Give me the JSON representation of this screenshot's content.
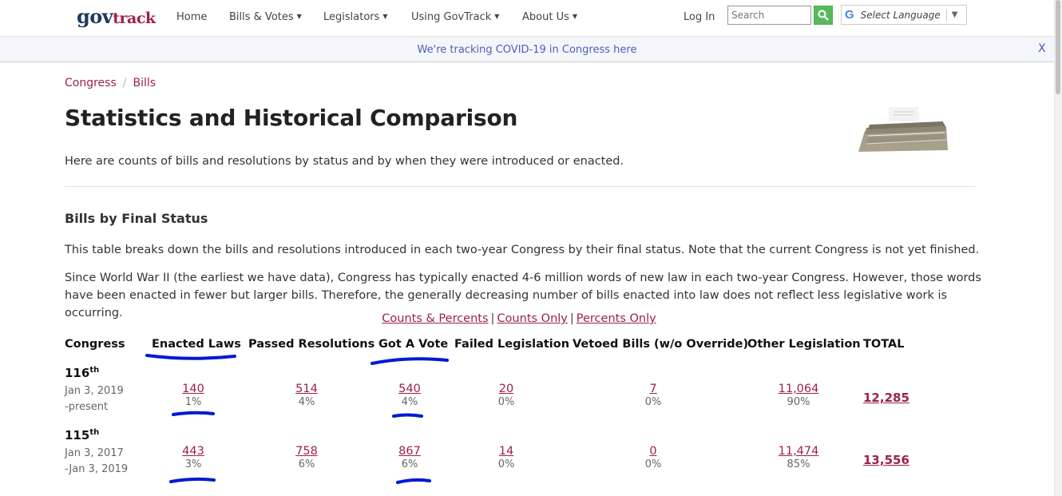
{
  "nav": {
    "logo_gov": "gov",
    "logo_track": "track",
    "items": [
      {
        "label": "Home",
        "has_caret": false
      },
      {
        "label": "Bills & Votes",
        "has_caret": true
      },
      {
        "label": "Legislators",
        "has_caret": true
      },
      {
        "label": "Using GovTrack",
        "has_caret": true
      },
      {
        "label": "About Us",
        "has_caret": true
      }
    ],
    "login": "Log In",
    "search_placeholder": "Search",
    "language_label": "Select Language",
    "search_icon": "search-icon",
    "brand_color": "#9d2146"
  },
  "banner": {
    "text": "We're tracking COVID-19 in Congress here",
    "close": "X"
  },
  "breadcrumb": [
    "Congress",
    "Bills"
  ],
  "title": "Statistics and Historical Comparison",
  "intro": "Here are counts of bills and resolutions by status and by when they were introduced or enacted.",
  "section": {
    "title": "Bills by Final Status",
    "para1": "This table breaks down the bills and resolutions introduced in each two-year Congress by their final status. Note that the current Congress is not yet finished.",
    "para2": "Since World War II (the earliest we have data), Congress has typically enacted 4-6 million words of new law in each two-year Congress. However, those words have been enacted in fewer but larger bills. Therefore, the generally decreasing number of bills enacted into law does not reflect less legislative work is occurring."
  },
  "toggles": [
    "Counts & Percents",
    "Counts Only",
    "Percents Only"
  ],
  "table": {
    "headers": [
      "Congress",
      "Enacted Laws",
      "Passed Resolutions",
      "Got A Vote",
      "Failed Legislation",
      "Vetoed Bills (w/o Override)",
      "Other Legislation",
      "TOTAL"
    ],
    "rows": [
      {
        "congress": "116",
        "suffix": "th",
        "date1": "Jan 3, 2019",
        "date2": "-present",
        "cells": [
          {
            "v": "140",
            "p": "1%"
          },
          {
            "v": "514",
            "p": "4%"
          },
          {
            "v": "540",
            "p": "4%"
          },
          {
            "v": "20",
            "p": "0%"
          },
          {
            "v": "7",
            "p": "0%"
          },
          {
            "v": "11,064",
            "p": "90%"
          }
        ],
        "total": "12,285"
      },
      {
        "congress": "115",
        "suffix": "th",
        "date1": "Jan 3, 2017",
        "date2": "-Jan 3, 2019",
        "cells": [
          {
            "v": "443",
            "p": "3%"
          },
          {
            "v": "758",
            "p": "6%"
          },
          {
            "v": "867",
            "p": "6%"
          },
          {
            "v": "14",
            "p": "0%"
          },
          {
            "v": "0",
            "p": "0%"
          },
          {
            "v": "11,474",
            "p": "85%"
          }
        ],
        "total": "13,556"
      }
    ]
  },
  "annotation_color": "#0019d6"
}
